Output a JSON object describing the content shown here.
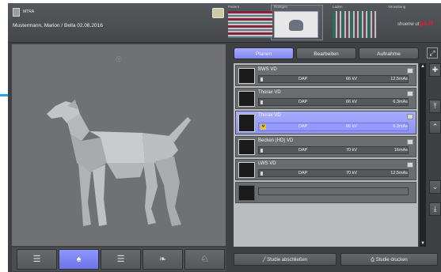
{
  "header": {
    "role": "MTRA",
    "patient": "Mustermann, Marion / Bella  02.08.2016",
    "tabs": [
      {
        "label": "Patient"
      },
      {
        "label": "Röntgen"
      },
      {
        "label": "Laden"
      },
      {
        "label": "Verwaltung"
      }
    ],
    "logo_text": "shuenw ut",
    "logo_brand": "gä.R"
  },
  "views": [
    "lateral-left",
    "dorsal",
    "lateral-right",
    "head",
    "pelvis"
  ],
  "tabs": [
    {
      "label": "Planen"
    },
    {
      "label": "Bearbeiten"
    },
    {
      "label": "Aufnahme"
    }
  ],
  "exams": [
    {
      "title": "BWS VD",
      "dap": "DAP",
      "kv": "66 kV",
      "mas": "12.5mAs",
      "selected": false,
      "radiation": false
    },
    {
      "title": "Thorax VD",
      "dap": "DAP",
      "kv": "66 kV",
      "mas": "6.3mAs",
      "selected": false,
      "radiation": false
    },
    {
      "title": "Thorax VD",
      "dap": "DAP",
      "kv": "66 kV",
      "mas": "6.3mAs",
      "selected": true,
      "radiation": true
    },
    {
      "title": "Becken (HD) VD",
      "dap": "DAP",
      "kv": "70 kV",
      "mas": "16mAs",
      "selected": false,
      "radiation": false
    },
    {
      "title": "LWS VD",
      "dap": "DAP",
      "kv": "70 kV",
      "mas": "12.5mAs",
      "selected": false,
      "radiation": false
    }
  ],
  "footer": {
    "finish_label": "Studie abschließen",
    "print_label": "Studie drucken"
  },
  "colors": {
    "accent": "#8d93f0",
    "selected": "#a8acff",
    "background": "#3e4043",
    "panel": "#6f7174"
  }
}
